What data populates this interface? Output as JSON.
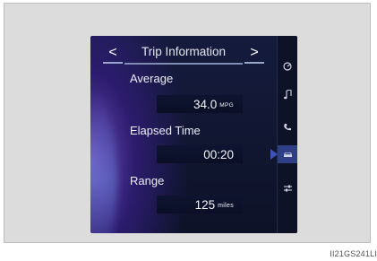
{
  "header": {
    "title": "Trip Information",
    "prev_label": "<",
    "next_label": ">"
  },
  "items": [
    {
      "label": "Average",
      "value": "34.0",
      "unit": "MPG"
    },
    {
      "label": "Elapsed Time",
      "value": "00:20",
      "unit": ""
    },
    {
      "label": "Range",
      "value": "125",
      "unit": "miles"
    }
  ],
  "sidebar": {
    "icons": [
      "gauge-icon",
      "music-note-icon",
      "phone-icon",
      "car-info-icon",
      "settings-icon"
    ],
    "active_index": 3
  },
  "caption": "II21GS241LI",
  "colors": {
    "screen_bg": "#151b3d",
    "accent": "#3c54b8",
    "text": "#eceef6"
  }
}
